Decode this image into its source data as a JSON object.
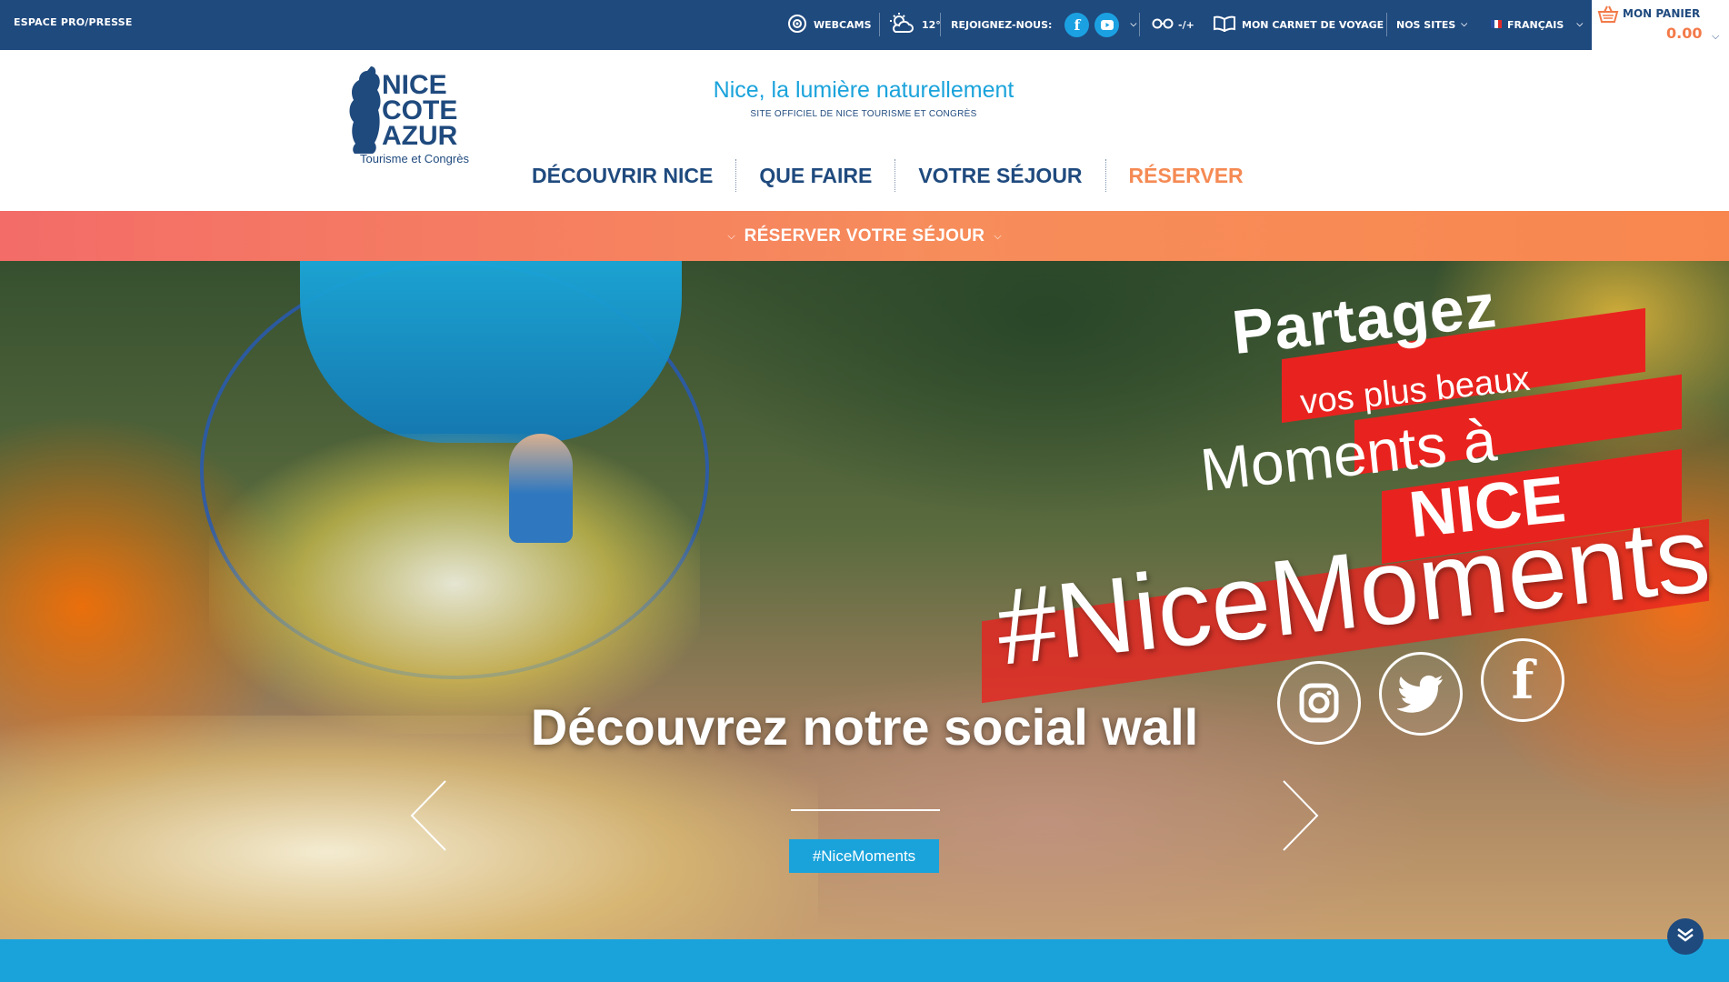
{
  "topbar": {
    "pro_label": "ESPACE PRO/PRESSE",
    "webcams_label": "WEBCAMS",
    "weather_temp": "12°",
    "join_label": "REJOIGNEZ-NOUS:",
    "social_icons": [
      "facebook-icon",
      "youtube-icon"
    ],
    "accessibility_label": "-/+",
    "carnet_label": "MON CARNET DE VOYAGE",
    "sites_label": "NOS SITES",
    "language_label": "FRANÇAIS",
    "cart_label": "MON PANIER",
    "cart_amount": "0.00"
  },
  "logo": {
    "line1": "NICE",
    "line2": "COTE",
    "line3": "AZUR",
    "subtitle": "Tourisme et Congrès"
  },
  "header": {
    "tagline": "Nice, la lumière naturellement",
    "subtitle": "SITE OFFICIEL DE NICE TOURISME ET CONGRÈS"
  },
  "nav": {
    "items": [
      {
        "label": "DÉCOUVRIR NICE"
      },
      {
        "label": "QUE FAIRE"
      },
      {
        "label": "VOTRE SÉJOUR"
      },
      {
        "label": "RÉSERVER"
      }
    ]
  },
  "booking": {
    "label": "RÉSERVER VOTRE SÉJOUR"
  },
  "hero": {
    "promo_line1": "Partagez",
    "promo_line2": "vos plus beaux",
    "promo_line3": "Moments à",
    "promo_line4": "NICE",
    "hashtag_art": "#NiceMoments",
    "title": "Découvrez notre social wall",
    "button_label": "#NiceMoments"
  },
  "colors": {
    "navy": "#1f4a7e",
    "sky": "#1aa3db",
    "orange": "#f58a54"
  }
}
